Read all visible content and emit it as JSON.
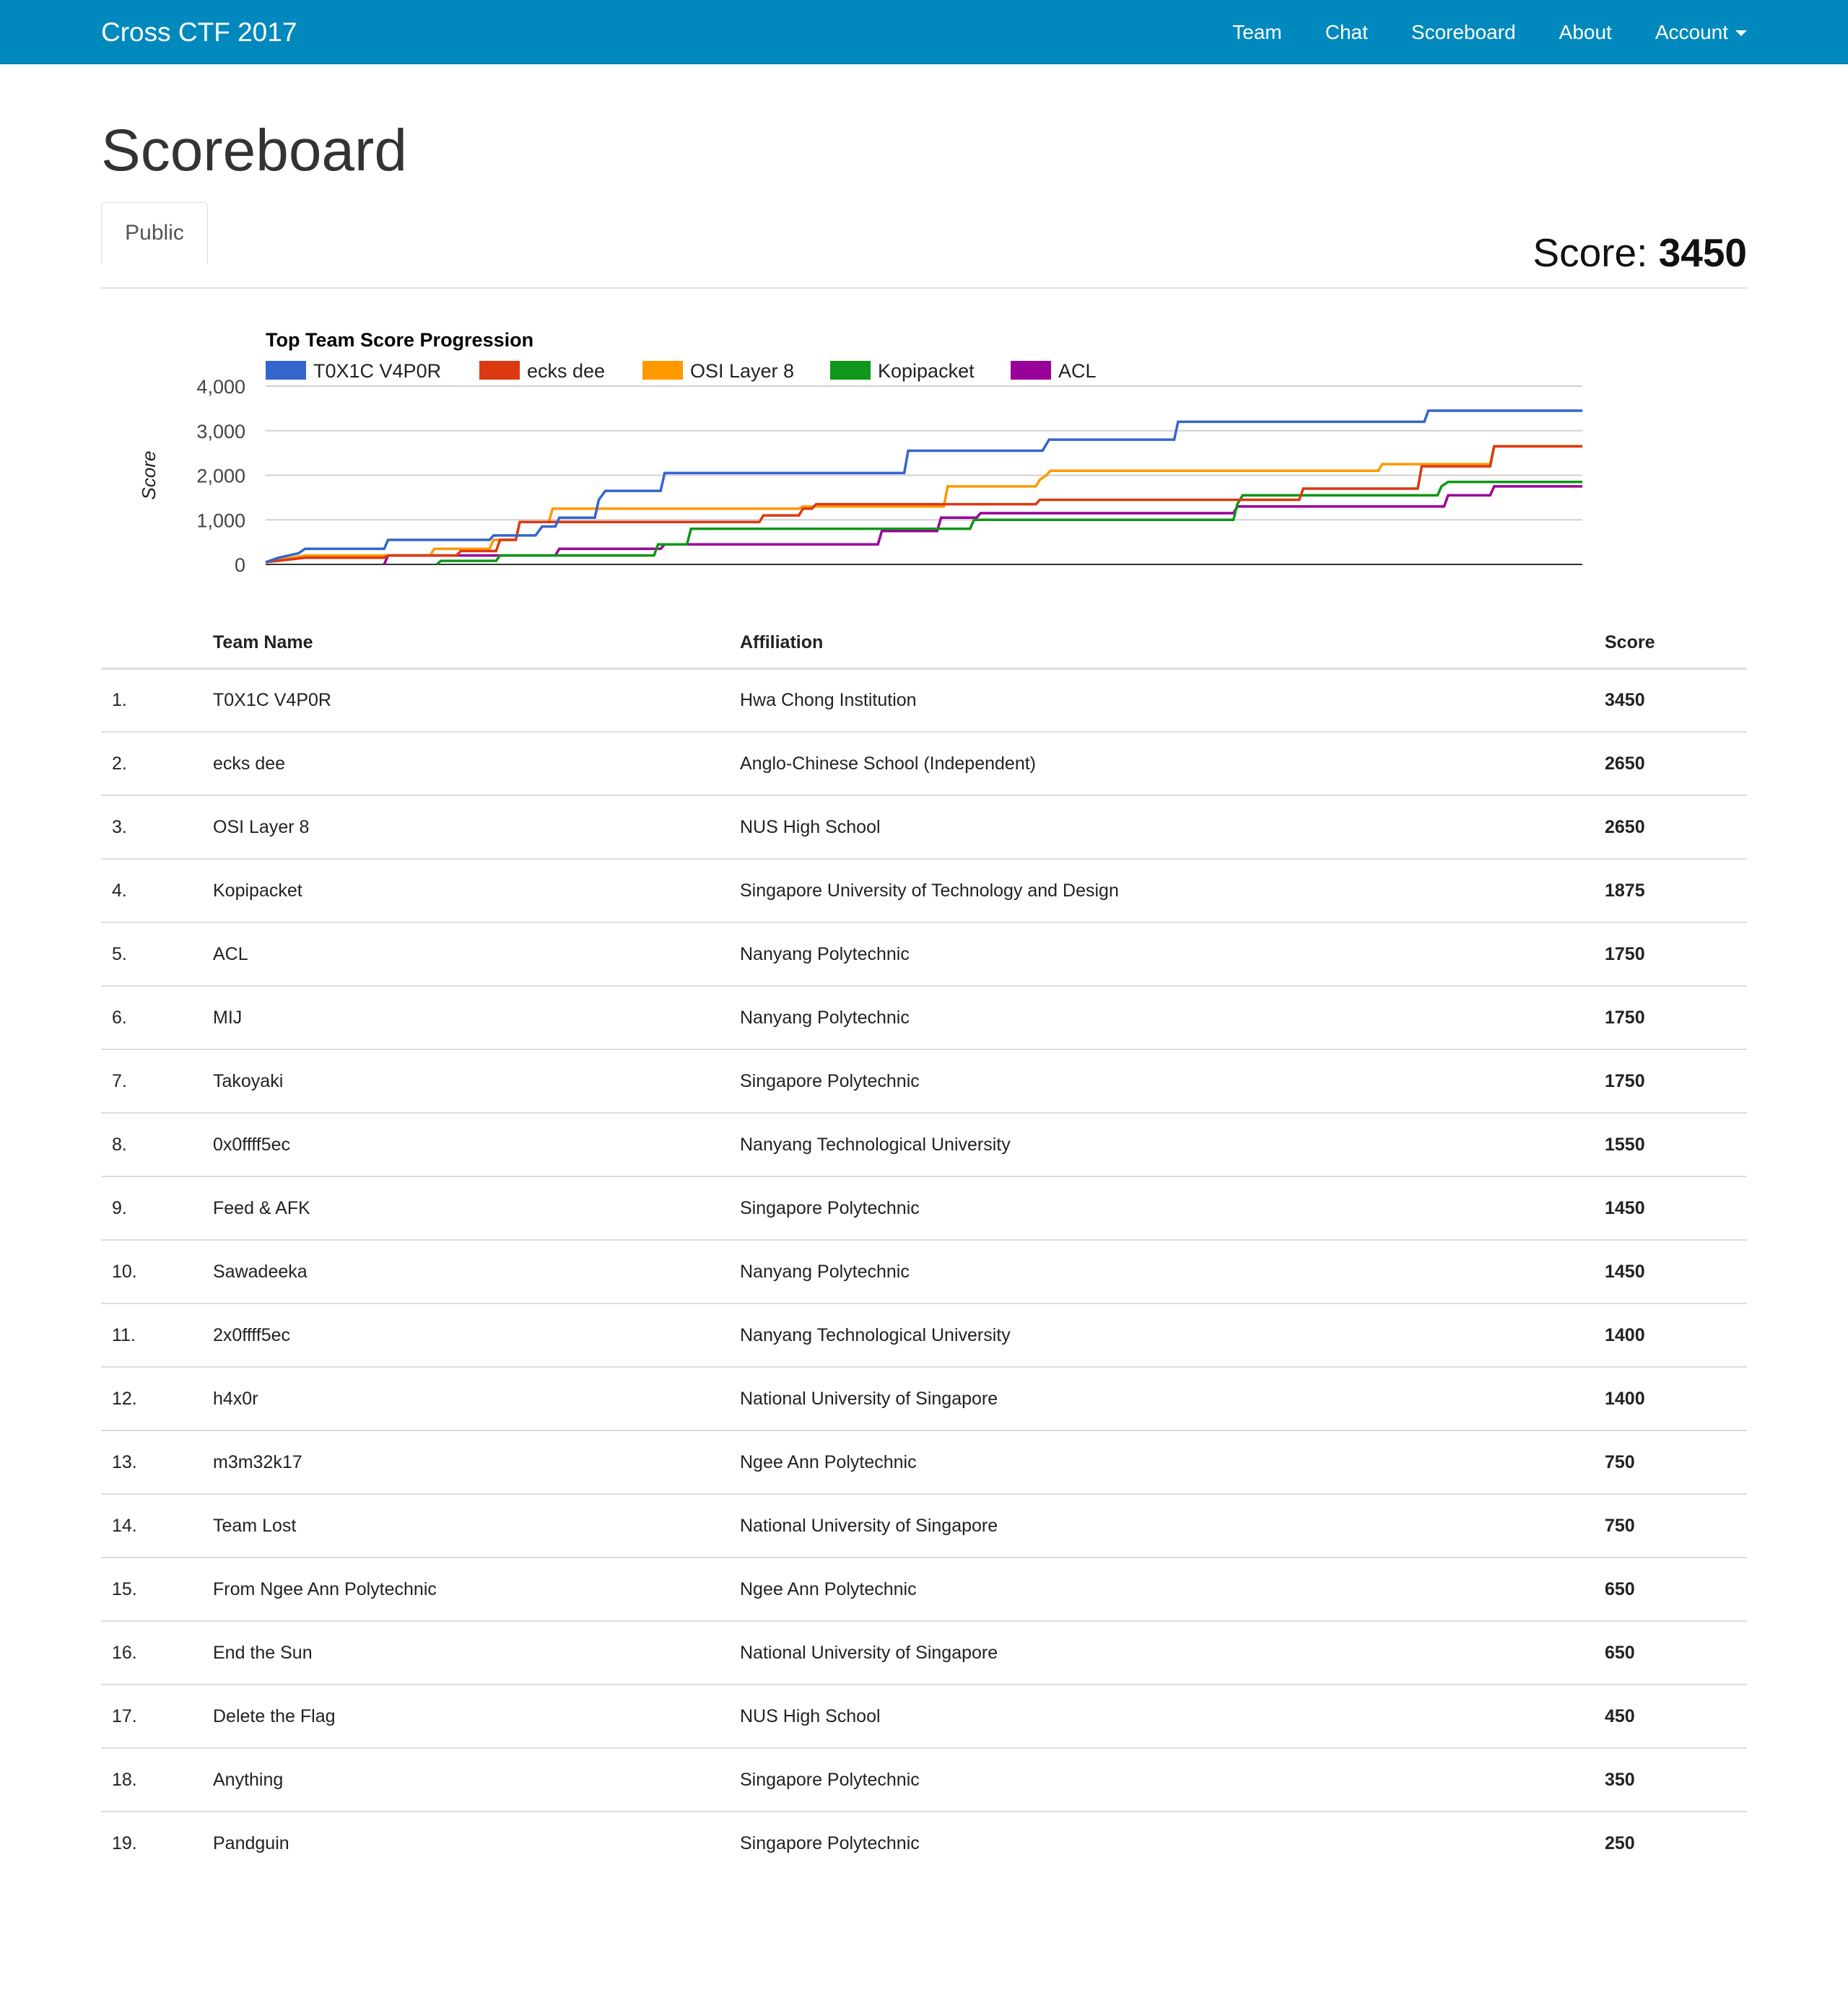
{
  "nav": {
    "brand": "Cross CTF 2017",
    "links": [
      "Team",
      "Chat",
      "Scoreboard",
      "About"
    ],
    "account": "Account"
  },
  "page": {
    "title": "Scoreboard",
    "tab": "Public",
    "score_label": "Score:",
    "score_value": "3450"
  },
  "chart_data": {
    "type": "line",
    "title": "Top Team Score Progression",
    "xlabel": "",
    "ylabel": "Score",
    "ylim": [
      0,
      4000
    ],
    "yticks": [
      "4,000",
      "3,000",
      "2,000",
      "1,000",
      "0"
    ],
    "ytick_values": [
      4000,
      3000,
      2000,
      1000,
      0
    ],
    "grid": true,
    "legend": "top",
    "xlim": [
      0,
      100
    ],
    "series": [
      {
        "name": "T0X1C V4P0R",
        "color": "#3366cc",
        "points": [
          [
            0,
            50
          ],
          [
            1,
            150
          ],
          [
            2.5,
            250
          ],
          [
            3,
            350
          ],
          [
            9,
            350
          ],
          [
            9.3,
            550
          ],
          [
            17,
            550
          ],
          [
            17.3,
            650
          ],
          [
            20.5,
            650
          ],
          [
            21,
            850
          ],
          [
            22,
            850
          ],
          [
            22.3,
            1050
          ],
          [
            25,
            1050
          ],
          [
            25.3,
            1450
          ],
          [
            25.8,
            1650
          ],
          [
            30,
            1650
          ],
          [
            30.3,
            2050
          ],
          [
            48.5,
            2050
          ],
          [
            48.8,
            2550
          ],
          [
            59,
            2550
          ],
          [
            59.2,
            2650
          ],
          [
            59.5,
            2800
          ],
          [
            69,
            2800
          ],
          [
            69.3,
            3200
          ],
          [
            88,
            3200
          ],
          [
            88.3,
            3450
          ],
          [
            100,
            3450
          ]
        ]
      },
      {
        "name": "ecks dee",
        "color": "#dc3912",
        "points": [
          [
            0,
            50
          ],
          [
            3,
            150
          ],
          [
            9,
            150
          ],
          [
            9.3,
            200
          ],
          [
            14.5,
            200
          ],
          [
            14.8,
            300
          ],
          [
            17.5,
            300
          ],
          [
            17.8,
            550
          ],
          [
            19,
            550
          ],
          [
            19.3,
            950
          ],
          [
            37.5,
            950
          ],
          [
            37.8,
            1100
          ],
          [
            40.5,
            1100
          ],
          [
            40.8,
            1250
          ],
          [
            41.5,
            1250
          ],
          [
            41.8,
            1350
          ],
          [
            58.5,
            1350
          ],
          [
            58.8,
            1450
          ],
          [
            78.5,
            1450
          ],
          [
            78.8,
            1700
          ],
          [
            87.5,
            1700
          ],
          [
            87.8,
            2200
          ],
          [
            93,
            2200
          ],
          [
            93.3,
            2650
          ],
          [
            100,
            2650
          ]
        ]
      },
      {
        "name": "OSI Layer 8",
        "color": "#ff9900",
        "points": [
          [
            0,
            50
          ],
          [
            3,
            200
          ],
          [
            12.5,
            200
          ],
          [
            12.8,
            350
          ],
          [
            17,
            350
          ],
          [
            17.3,
            550
          ],
          [
            19,
            550
          ],
          [
            19.3,
            950
          ],
          [
            21.5,
            950
          ],
          [
            21.8,
            1250
          ],
          [
            40.5,
            1250
          ],
          [
            40.8,
            1300
          ],
          [
            51.5,
            1300
          ],
          [
            51.8,
            1750
          ],
          [
            58.5,
            1750
          ],
          [
            58.8,
            1900
          ],
          [
            59.3,
            2000
          ],
          [
            59.6,
            2100
          ],
          [
            84.5,
            2100
          ],
          [
            84.8,
            2250
          ],
          [
            93,
            2250
          ],
          [
            93.3,
            2650
          ],
          [
            100,
            2650
          ]
        ]
      },
      {
        "name": "Kopipacket",
        "color": "#109618",
        "points": [
          [
            13,
            0
          ],
          [
            13.3,
            80
          ],
          [
            17.5,
            80
          ],
          [
            17.8,
            200
          ],
          [
            29.5,
            200
          ],
          [
            29.8,
            450
          ],
          [
            32,
            450
          ],
          [
            32.3,
            800
          ],
          [
            53.5,
            800
          ],
          [
            53.8,
            1000
          ],
          [
            73.5,
            1000
          ],
          [
            73.8,
            1350
          ],
          [
            74.2,
            1550
          ],
          [
            89,
            1550
          ],
          [
            89.3,
            1750
          ],
          [
            89.8,
            1850
          ],
          [
            100,
            1850
          ]
        ]
      },
      {
        "name": "ACL",
        "color": "#990099",
        "points": [
          [
            9,
            0
          ],
          [
            9.3,
            200
          ],
          [
            22,
            200
          ],
          [
            22.3,
            350
          ],
          [
            30,
            350
          ],
          [
            30.3,
            450
          ],
          [
            46.5,
            450
          ],
          [
            46.8,
            750
          ],
          [
            51,
            750
          ],
          [
            51.3,
            1050
          ],
          [
            54,
            1050
          ],
          [
            54.3,
            1150
          ],
          [
            73.5,
            1150
          ],
          [
            73.8,
            1300
          ],
          [
            89.5,
            1300
          ],
          [
            89.8,
            1550
          ],
          [
            93,
            1550
          ],
          [
            93.3,
            1750
          ],
          [
            100,
            1750
          ]
        ]
      }
    ]
  },
  "table": {
    "headers": [
      "",
      "Team Name",
      "Affiliation",
      "Score"
    ],
    "rows": [
      [
        "1.",
        "T0X1C V4P0R",
        "Hwa Chong Institution",
        "3450"
      ],
      [
        "2.",
        "ecks dee",
        "Anglo-Chinese School (Independent)",
        "2650"
      ],
      [
        "3.",
        "OSI Layer 8",
        "NUS High School",
        "2650"
      ],
      [
        "4.",
        "Kopipacket",
        "Singapore University of Technology and Design",
        "1875"
      ],
      [
        "5.",
        "ACL",
        "Nanyang Polytechnic",
        "1750"
      ],
      [
        "6.",
        "MIJ",
        "Nanyang Polytechnic",
        "1750"
      ],
      [
        "7.",
        "Takoyaki",
        "Singapore Polytechnic",
        "1750"
      ],
      [
        "8.",
        "0x0ffff5ec",
        "Nanyang Technological University",
        "1550"
      ],
      [
        "9.",
        "Feed & AFK",
        "Singapore Polytechnic",
        "1450"
      ],
      [
        "10.",
        "Sawadeeka",
        "Nanyang Polytechnic",
        "1450"
      ],
      [
        "11.",
        "2x0ffff5ec",
        "Nanyang Technological University",
        "1400"
      ],
      [
        "12.",
        "h4x0r",
        "National University of Singapore",
        "1400"
      ],
      [
        "13.",
        "m3m32k17",
        "Ngee Ann Polytechnic",
        "750"
      ],
      [
        "14.",
        "Team Lost",
        "National University of Singapore",
        "750"
      ],
      [
        "15.",
        "From Ngee Ann Polytechnic",
        "Ngee Ann Polytechnic",
        "650"
      ],
      [
        "16.",
        "End the Sun",
        "National University of Singapore",
        "650"
      ],
      [
        "17.",
        "Delete the Flag",
        "NUS High School",
        "450"
      ],
      [
        "18.",
        "Anything",
        "Singapore Polytechnic",
        "350"
      ],
      [
        "19.",
        "Pandguin",
        "Singapore Polytechnic",
        "250"
      ]
    ]
  }
}
